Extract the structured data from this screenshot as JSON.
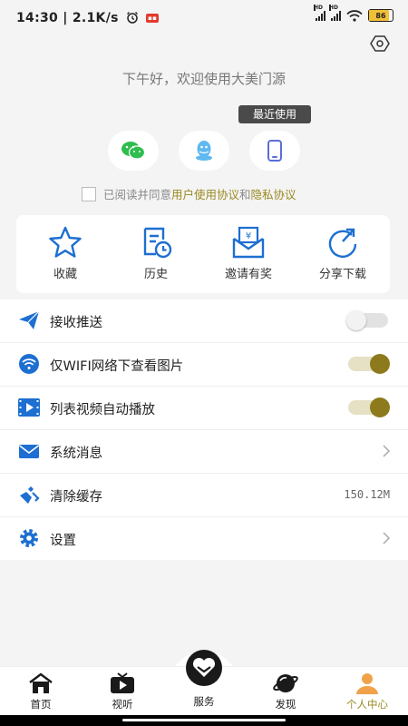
{
  "status_bar": {
    "time": "14:30",
    "speed": "2.1K/s",
    "battery": "86",
    "hd1": "HD",
    "hd2": "HD",
    "battery_level": 0.86
  },
  "greeting": "下午好，欢迎使用大美门源",
  "recent_tag": "最近使用",
  "login_icons": [
    "wechat-icon",
    "qq-icon",
    "phone-icon"
  ],
  "agreement": {
    "prefix": "已阅读并同意",
    "user_agreement": "用户使用协议",
    "and": "和",
    "privacy": "隐私协议"
  },
  "quick_actions": [
    {
      "label": "收藏",
      "icon": "star-icon"
    },
    {
      "label": "历史",
      "icon": "history-icon"
    },
    {
      "label": "邀请有奖",
      "icon": "invite-reward-icon"
    },
    {
      "label": "分享下载",
      "icon": "share-icon"
    }
  ],
  "settings_list": [
    {
      "label": "接收推送",
      "icon": "paper-plane-icon",
      "control": "toggle",
      "on": false
    },
    {
      "label": "仅WIFI网络下查看图片",
      "icon": "wifi-icon",
      "control": "toggle",
      "on": true
    },
    {
      "label": "列表视频自动播放",
      "icon": "video-icon",
      "control": "toggle",
      "on": true
    },
    {
      "label": "系统消息",
      "icon": "mail-icon",
      "control": "chevron"
    },
    {
      "label": "清除缓存",
      "icon": "broom-icon",
      "control": "value",
      "value": "150.12M"
    },
    {
      "label": "设置",
      "icon": "gear-icon",
      "control": "chevron"
    }
  ],
  "tabs": [
    {
      "label": "首页",
      "icon": "home-icon",
      "active": false
    },
    {
      "label": "视听",
      "icon": "tv-icon",
      "active": false
    },
    {
      "label": "服务",
      "icon": "heart-icon",
      "active": false
    },
    {
      "label": "发现",
      "icon": "planet-icon",
      "active": false
    },
    {
      "label": "个人中心",
      "icon": "person-icon",
      "active": true
    }
  ],
  "colors": {
    "accent": "#9a8920",
    "icon_blue": "#1d6fd1",
    "toggle_on": "#8c7a1c"
  }
}
